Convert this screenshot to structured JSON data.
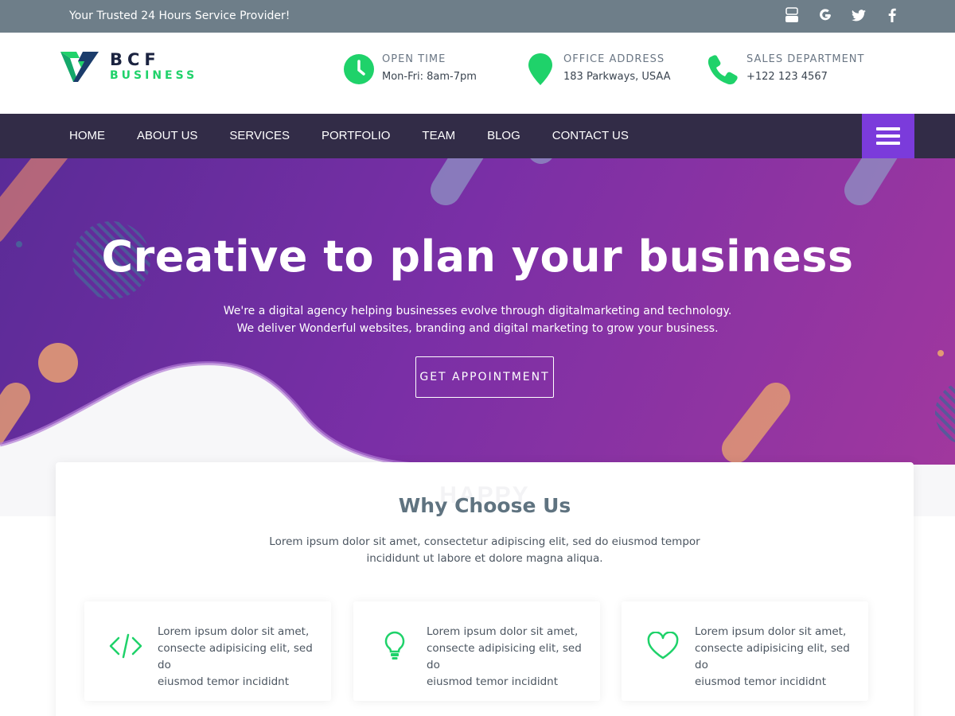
{
  "topbar": {
    "tagline": "Your Trusted 24 Hours Service Provider!",
    "socials": [
      "youtube-icon",
      "google-icon",
      "twitter-icon",
      "facebook-icon"
    ],
    "bg_color": "#6e7e89"
  },
  "header": {
    "logo_name": "BCF",
    "logo_sub": "BUSINESS",
    "info": [
      {
        "title": "OPEN TIME",
        "value": "Mon-Fri: 8am-7pm",
        "icon": "clock-icon"
      },
      {
        "title": "OFFICE ADDRESS",
        "value": "183 Parkways, USAA",
        "icon": "map-pin-icon"
      },
      {
        "title": "SALES DEPARTMENT",
        "value": "+122 123 4567",
        "icon": "phone-icon"
      }
    ],
    "accent_color": "#1fd26a"
  },
  "nav": {
    "items": [
      "HOME",
      "ABOUT US",
      "SERVICES",
      "PORTFOLIO",
      "TEAM",
      "BLOG",
      "CONTACT US"
    ],
    "menu_icon": "hamburger-icon",
    "bg_color": "#322c47",
    "menu_color": "#7b3bdb"
  },
  "hero": {
    "title": "Creative to plan your business",
    "subtitle_line1": "We're a digital agency helping businesses evolve through digitalmarketing and technology.",
    "subtitle_line2": "We deliver Wonderful websites, branding and digital marketing to grow your business.",
    "cta": "GET APPOINTMENT"
  },
  "why": {
    "ghost": "HAPPY",
    "title": "Why Choose Us",
    "desc_line1": "Lorem ipsum dolor sit amet, consectetur adipiscing elit, sed do eiusmod tempor",
    "desc_line2": "incididunt ut labore et dolore magna aliqua.",
    "features": [
      {
        "icon": "code-icon",
        "line1": "Lorem ipsum dolor sit amet,",
        "line2": "consecte adipisicing elit, sed do",
        "line3": "eiusmod temor incididnt"
      },
      {
        "icon": "lightbulb-icon",
        "line1": "Lorem ipsum dolor sit amet,",
        "line2": "consecte adipisicing elit, sed do",
        "line3": "eiusmod temor incididnt"
      },
      {
        "icon": "heart-icon",
        "line1": "Lorem ipsum dolor sit amet,",
        "line2": "consecte adipisicing elit, sed do",
        "line3": "eiusmod temor incididnt"
      }
    ]
  }
}
